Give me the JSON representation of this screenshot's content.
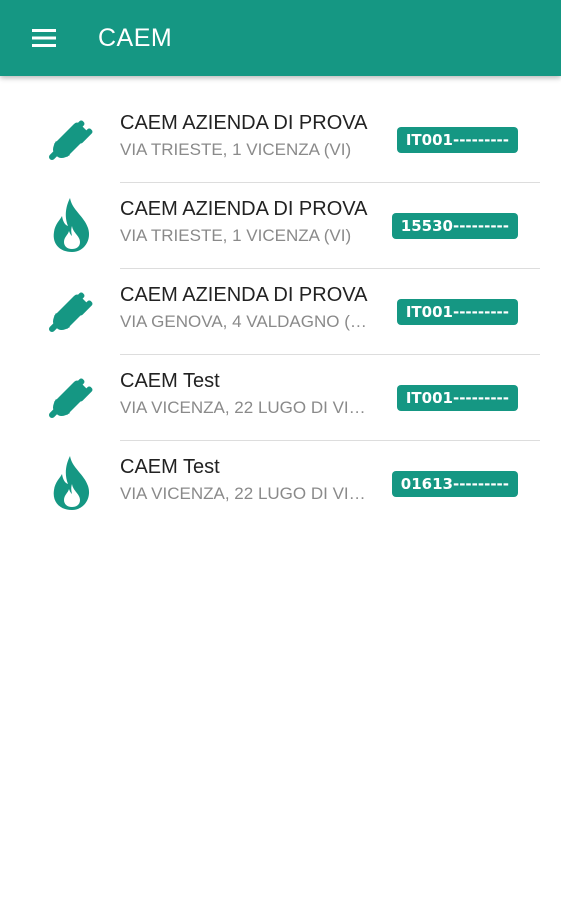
{
  "app_bar": {
    "title": "CAEM",
    "menu_icon": "hamburger-menu-icon",
    "background_color": "#159783"
  },
  "accent_color": "#159783",
  "supplies": [
    {
      "icon": "plug-icon",
      "title": "CAEM AZIENDA DI PROVA",
      "address": "VIA TRIESTE, 1 VICENZA (VI)",
      "code": "IT001---------"
    },
    {
      "icon": "flame-icon",
      "title": "CAEM AZIENDA DI PROVA",
      "address": "VIA TRIESTE, 1 VICENZA (VI)",
      "code": "15530---------"
    },
    {
      "icon": "plug-icon",
      "title": "CAEM AZIENDA DI PROVA",
      "address": "VIA GENOVA, 4 VALDAGNO (…",
      "code": "IT001---------"
    },
    {
      "icon": "plug-icon",
      "title": "CAEM Test",
      "address": "VIA VICENZA, 22 LUGO DI VI…",
      "code": "IT001---------"
    },
    {
      "icon": "flame-icon",
      "title": "CAEM Test",
      "address": "VIA VICENZA, 22 LUGO DI VI…",
      "code": "01613---------"
    }
  ]
}
